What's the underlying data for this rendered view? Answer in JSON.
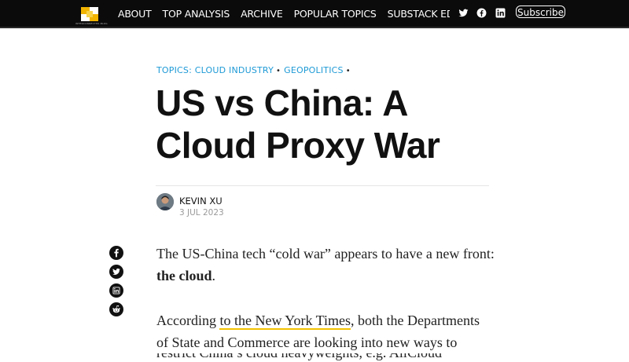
{
  "nav": {
    "logo_caption": "INTERCONNECTED.BLOG",
    "menu": [
      "ABOUT",
      "TOP ANALYSIS",
      "ARCHIVE",
      "POPULAR TOPICS",
      "SUBSTACK EDITION"
    ],
    "subscribe_label": "Subscribe",
    "social_icons": [
      "twitter-icon",
      "facebook-icon",
      "linkedin-icon"
    ]
  },
  "article": {
    "topics_prefix": "TOPICS:",
    "topics": [
      "CLOUD INDUSTRY",
      "GEOPOLITICS"
    ],
    "title": "US vs China: A Cloud Proxy War",
    "author": "KEVIN XU",
    "date": "3 JUL 2023",
    "share_icons": [
      "facebook-icon",
      "twitter-icon",
      "linkedin-icon",
      "reddit-icon"
    ],
    "p1_start": "The US-China tech “cold war” appears to have a new front: ",
    "p1_bold": "the cloud",
    "p1_end": ".",
    "p2_start": "According ",
    "p2_link": "to the New York Times",
    "p2_end": ", both the Departments of State and Commerce are looking into new ways to",
    "p3_partial": "restrict China’s cloud heavyweights, e.g. AliCloud"
  },
  "colors": {
    "nav_bg": "#0b0b0b",
    "accent_link": "#1e9ad6",
    "underline": "#f2c200",
    "logo_yellow": "#f2b400"
  }
}
